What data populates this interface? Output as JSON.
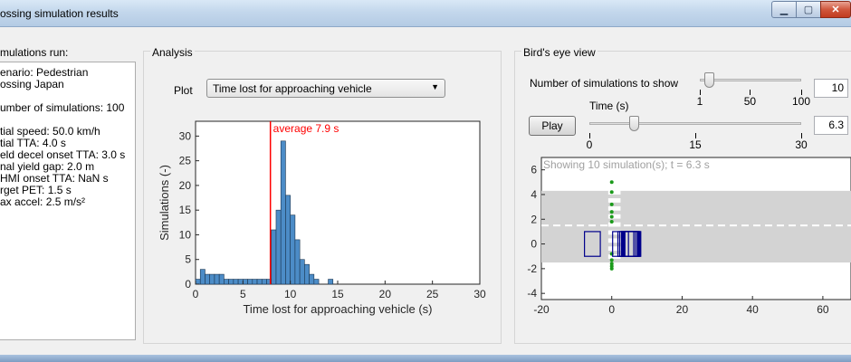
{
  "window": {
    "title": "ossing simulation results",
    "buttons": {
      "minimize": "▁",
      "maximize": "▢",
      "close": "✕"
    }
  },
  "left_panel": {
    "label": "mulations run:",
    "lines": [
      "enario: Pedestrian",
      "ossing Japan",
      "",
      "umber of simulations: 100",
      "",
      "tial speed: 50.0 km/h",
      "tial TTA: 4.0 s",
      "eld decel onset TTA: 3.0 s",
      "nal yield gap: 2.0 m",
      "HMI onset TTA: NaN s",
      "rget PET: 1.5 s",
      "ax accel: 2.5 m/s²"
    ]
  },
  "analysis": {
    "label": "Analysis",
    "plot_label": "Plot",
    "plot_select": "Time lost for approaching vehicle"
  },
  "birds_eye": {
    "label": "Bird's eye view",
    "num_sims_label": "Number of simulations to show",
    "num_sims_value": "10",
    "num_sims_slider": {
      "min": 1,
      "max": 100,
      "value": 10,
      "ticks": [
        "1",
        "50",
        "100"
      ]
    },
    "time_label": "Time (s)",
    "play_label": "Play",
    "time_value": "6.3",
    "time_slider": {
      "min": 0,
      "max": 30,
      "value": 6.3,
      "ticks": [
        "0",
        "15",
        "30"
      ]
    }
  },
  "chart_data": [
    {
      "type": "bar",
      "title": "",
      "xlabel": "Time lost for approaching vehicle (s)",
      "ylabel": "Simulations (-)",
      "xlim": [
        0,
        30
      ],
      "ylim": [
        0,
        33
      ],
      "xticks": [
        0,
        5,
        10,
        15,
        20,
        25,
        30
      ],
      "yticks": [
        0,
        5,
        10,
        15,
        20,
        25,
        30
      ],
      "bin_width": 0.5,
      "bin_starts": [
        0,
        0.5,
        1,
        1.5,
        2,
        2.5,
        3,
        3.5,
        4,
        4.5,
        5,
        5.5,
        6,
        6.5,
        7,
        7.5,
        8,
        8.5,
        9,
        9.5,
        10,
        10.5,
        11,
        11.5,
        12,
        12.5,
        13,
        13.5,
        14,
        14.5
      ],
      "counts": [
        1,
        3,
        2,
        2,
        2,
        2,
        1,
        1,
        1,
        1,
        1,
        1,
        1,
        1,
        1,
        1,
        11,
        15,
        29,
        18,
        14,
        9,
        5,
        4,
        2,
        1,
        0,
        0,
        1,
        0
      ],
      "annotation": {
        "x": 7.9,
        "text": "average 7.9 s",
        "color": "#ff0000"
      },
      "bar_color": "#4c8cc7",
      "grid": false
    },
    {
      "type": "scatter",
      "title": "Showing 10 simulation(s); t = 6.3 s",
      "xlim": [
        -20,
        68
      ],
      "ylim": [
        -4.5,
        7
      ],
      "xticks": [
        -20,
        0,
        20,
        40,
        60
      ],
      "yticks": [
        -4,
        -2,
        0,
        2,
        4,
        6
      ],
      "road": {
        "y_min": -1.5,
        "y_max": 4.3,
        "centerline_y": 1.5,
        "color": "#d3d3d3"
      },
      "crosswalk": {
        "x_min": -1,
        "x_max": 2.5,
        "y_min": -1.5,
        "y_max": 4.3
      },
      "pedestrians_y": [
        5,
        4.2,
        3.2,
        2.6,
        2.2,
        1.8,
        -0.8,
        -1.3,
        -1.6,
        -1.8,
        -2
      ],
      "pedestrian_color": "#1a9a1a",
      "vehicles_x": [
        -5.5,
        2.5,
        4,
        4.5,
        5,
        5.2,
        5.4,
        5.6,
        5.8,
        6
      ],
      "vehicle_y": 0,
      "vehicle_length": 4.5,
      "vehicle_width": 2,
      "vehicle_color": "#00008b",
      "grid": false
    }
  ]
}
